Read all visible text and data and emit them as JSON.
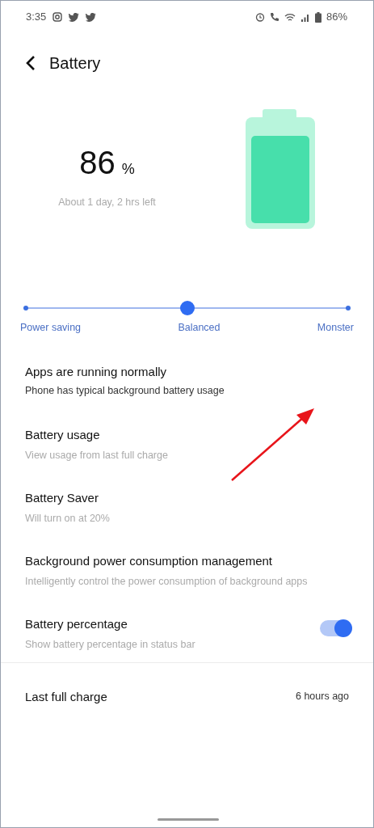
{
  "status_bar": {
    "time": "3:35",
    "battery": "86%"
  },
  "header": {
    "title": "Battery"
  },
  "battery": {
    "percent": "86",
    "unit": "%",
    "estimate": "About 1 day, 2 hrs left"
  },
  "mode_slider": {
    "options": [
      {
        "label": "Power saving",
        "selected": false
      },
      {
        "label": "Balanced",
        "selected": true
      },
      {
        "label": "Monster",
        "selected": false
      }
    ]
  },
  "items": [
    {
      "kind": "status",
      "title": "Apps are running normally",
      "subtitle": "Phone has typical background battery usage"
    },
    {
      "kind": "plain",
      "title": "Battery usage",
      "subtitle": "View usage from last full charge"
    },
    {
      "kind": "plain",
      "title": "Battery Saver",
      "subtitle": "Will turn on at 20%"
    },
    {
      "kind": "plain",
      "title": "Background power consumption management",
      "subtitle": "Intelligently control the power consumption of background apps"
    },
    {
      "kind": "toggle",
      "title": "Battery percentage",
      "subtitle": "Show battery percentage in status bar",
      "on": true
    },
    {
      "kind": "value",
      "title": "Last full charge",
      "value": "6 hours ago"
    }
  ]
}
